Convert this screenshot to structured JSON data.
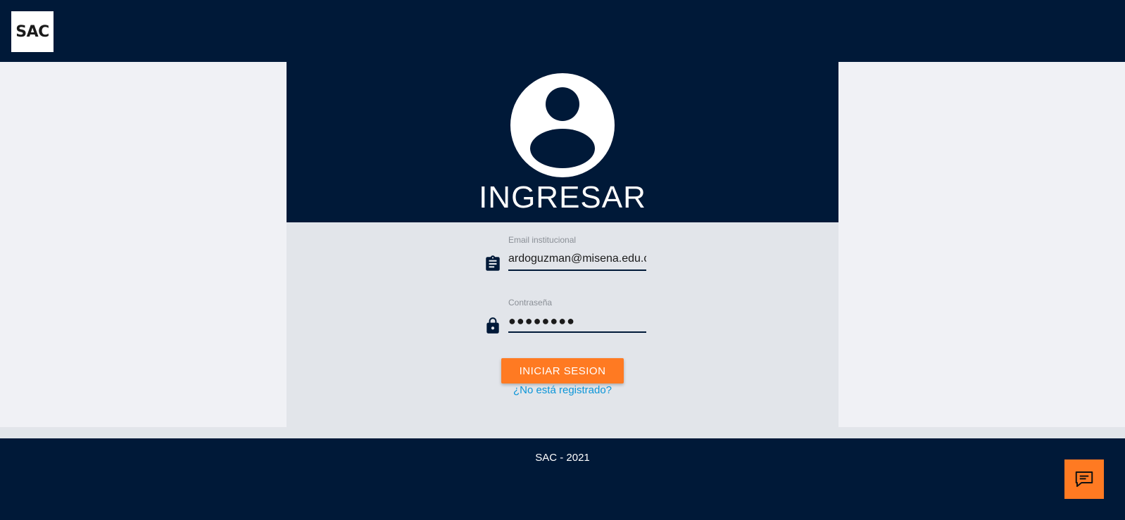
{
  "header": {
    "logo_text": "SAC"
  },
  "login": {
    "title": "INGRESAR",
    "email": {
      "label": "Email institucional",
      "value": "ardoguzman@misena.edu.co"
    },
    "password": {
      "label": "Contraseña",
      "value": "●●●●●●●●"
    },
    "submit_label": "INICIAR SESION",
    "register_link": "¿No está registrado?"
  },
  "footer": {
    "text": "SAC - 2021"
  },
  "icons": {
    "avatar": "account-circle-icon",
    "email": "clipboard-icon",
    "password": "lock-icon",
    "chat": "chat-icon"
  },
  "colors": {
    "navy": "#001938",
    "accent": "#ff7a22",
    "link": "#0b95d8",
    "panel": "#e2e5ea",
    "background": "#f0f1f5"
  }
}
